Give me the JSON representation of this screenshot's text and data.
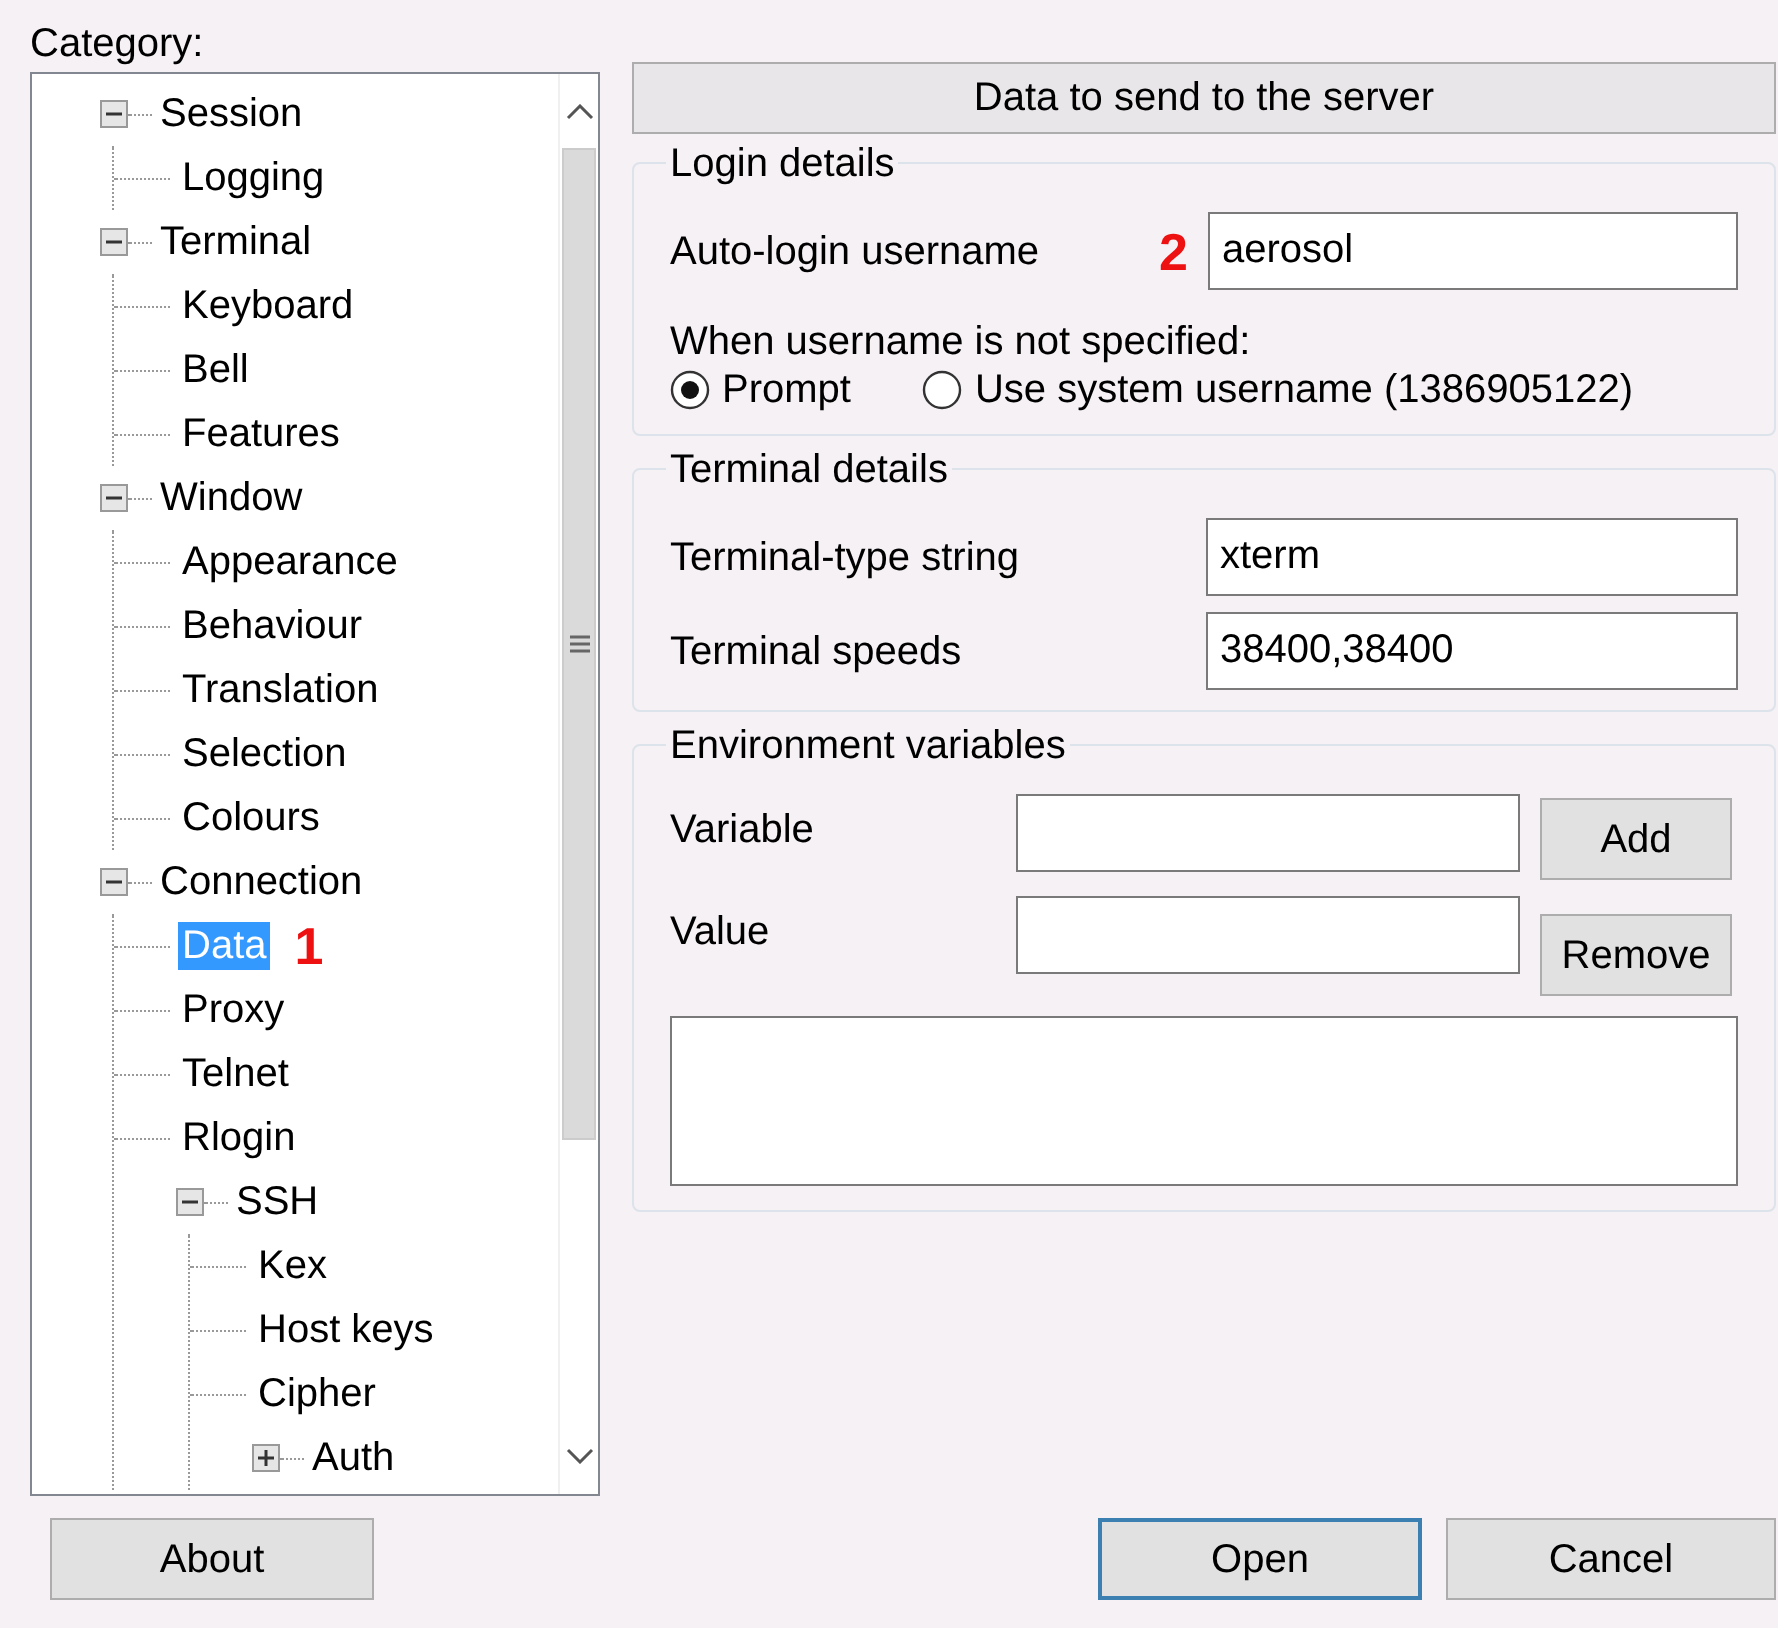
{
  "category_label": "Category:",
  "tree": [
    {
      "label": "Session",
      "expanded": true,
      "selected": false,
      "children": [
        {
          "label": "Logging",
          "selected": false
        }
      ]
    },
    {
      "label": "Terminal",
      "expanded": true,
      "selected": false,
      "children": [
        {
          "label": "Keyboard",
          "selected": false
        },
        {
          "label": "Bell",
          "selected": false
        },
        {
          "label": "Features",
          "selected": false
        }
      ]
    },
    {
      "label": "Window",
      "expanded": true,
      "selected": false,
      "children": [
        {
          "label": "Appearance",
          "selected": false
        },
        {
          "label": "Behaviour",
          "selected": false
        },
        {
          "label": "Translation",
          "selected": false
        },
        {
          "label": "Selection",
          "selected": false
        },
        {
          "label": "Colours",
          "selected": false
        }
      ]
    },
    {
      "label": "Connection",
      "expanded": true,
      "selected": false,
      "children": [
        {
          "label": "Data",
          "selected": true,
          "marker": "1"
        },
        {
          "label": "Proxy",
          "selected": false
        },
        {
          "label": "Telnet",
          "selected": false
        },
        {
          "label": "Rlogin",
          "selected": false
        },
        {
          "label": "SSH",
          "expanded": true,
          "selected": false,
          "children": [
            {
              "label": "Kex",
              "selected": false
            },
            {
              "label": "Host keys",
              "selected": false
            },
            {
              "label": "Cipher",
              "selected": false
            },
            {
              "label": "Auth",
              "expanded": false,
              "selected": false
            }
          ]
        }
      ]
    }
  ],
  "panel_title": "Data to send to the server",
  "login_group": {
    "title": "Login details",
    "username_label": "Auto-login username",
    "marker": "2",
    "username_value": "aerosol",
    "unspecified_label": "When username is not specified:",
    "radios": [
      {
        "label": "Prompt",
        "selected": true
      },
      {
        "label": "Use system username (1386905122)",
        "selected": false
      }
    ]
  },
  "terminal_group": {
    "title": "Terminal details",
    "fields": [
      {
        "label": "Terminal-type string",
        "value": "xterm"
      },
      {
        "label": "Terminal speeds",
        "value": "38400,38400"
      }
    ]
  },
  "env_group": {
    "title": "Environment variables",
    "variable_label": "Variable",
    "value_label": "Value",
    "add_button": "Add",
    "remove_button": "Remove"
  },
  "buttons": [
    {
      "label": "About",
      "default": false
    },
    {
      "label": "Open",
      "default": true
    },
    {
      "label": "Cancel",
      "default": false
    }
  ]
}
